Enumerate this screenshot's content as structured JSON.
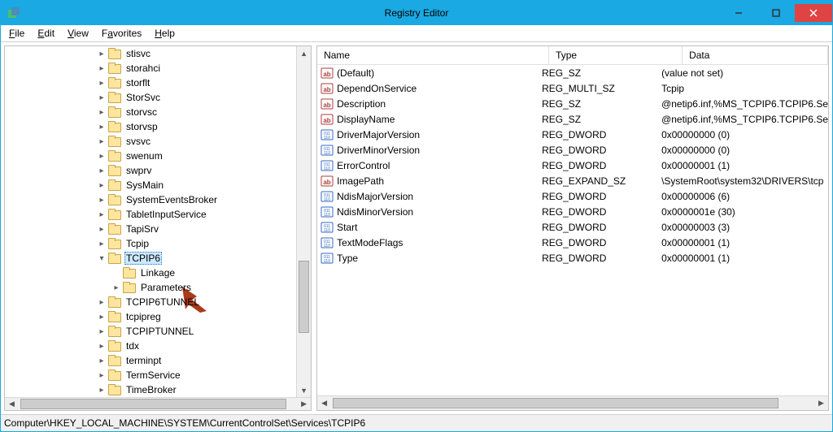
{
  "window": {
    "title": "Registry Editor"
  },
  "menu": {
    "items": [
      {
        "k": "F",
        "r": "ile"
      },
      {
        "k": "E",
        "r": "dit"
      },
      {
        "k": "V",
        "r": "iew"
      },
      {
        "k": "F",
        "r": "avorites",
        "pre": ""
      },
      {
        "k": "H",
        "r": "elp"
      }
    ]
  },
  "tree": {
    "indent_base": 112,
    "selected": "TCPIP6",
    "items": [
      {
        "l": "stisvc",
        "exp": "c"
      },
      {
        "l": "storahci",
        "exp": "c"
      },
      {
        "l": "storflt",
        "exp": "c"
      },
      {
        "l": "StorSvc",
        "exp": "c"
      },
      {
        "l": "storvsc",
        "exp": "c"
      },
      {
        "l": "storvsp",
        "exp": "c"
      },
      {
        "l": "svsvc",
        "exp": "c"
      },
      {
        "l": "swenum",
        "exp": "c"
      },
      {
        "l": "swprv",
        "exp": "c"
      },
      {
        "l": "SysMain",
        "exp": "c"
      },
      {
        "l": "SystemEventsBroker",
        "exp": "c"
      },
      {
        "l": "TabletInputService",
        "exp": "c"
      },
      {
        "l": "TapiSrv",
        "exp": "c"
      },
      {
        "l": "Tcpip",
        "exp": "c"
      },
      {
        "l": "TCPIP6",
        "exp": "o",
        "sel": true
      },
      {
        "l": "Linkage",
        "exp": "",
        "indent": 1
      },
      {
        "l": "Parameters",
        "exp": "c",
        "indent": 1
      },
      {
        "l": "TCPIP6TUNNEL",
        "exp": "c"
      },
      {
        "l": "tcpipreg",
        "exp": "c"
      },
      {
        "l": "TCPIPTUNNEL",
        "exp": "c"
      },
      {
        "l": "tdx",
        "exp": "c"
      },
      {
        "l": "terminpt",
        "exp": "c"
      },
      {
        "l": "TermService",
        "exp": "c"
      },
      {
        "l": "TimeBroker",
        "exp": "c"
      }
    ]
  },
  "list": {
    "columns": {
      "name": "Name",
      "type": "Type",
      "data": "Data"
    },
    "rows": [
      {
        "icon": "str",
        "name": "(Default)",
        "type": "REG_SZ",
        "data": "(value not set)"
      },
      {
        "icon": "str",
        "name": "DependOnService",
        "type": "REG_MULTI_SZ",
        "data": "Tcpip"
      },
      {
        "icon": "str",
        "name": "Description",
        "type": "REG_SZ",
        "data": "@netip6.inf,%MS_TCPIP6.TCPIP6.Se"
      },
      {
        "icon": "str",
        "name": "DisplayName",
        "type": "REG_SZ",
        "data": "@netip6.inf,%MS_TCPIP6.TCPIP6.Se"
      },
      {
        "icon": "bin",
        "name": "DriverMajorVersion",
        "type": "REG_DWORD",
        "data": "0x00000000 (0)"
      },
      {
        "icon": "bin",
        "name": "DriverMinorVersion",
        "type": "REG_DWORD",
        "data": "0x00000000 (0)"
      },
      {
        "icon": "bin",
        "name": "ErrorControl",
        "type": "REG_DWORD",
        "data": "0x00000001 (1)"
      },
      {
        "icon": "str",
        "name": "ImagePath",
        "type": "REG_EXPAND_SZ",
        "data": "\\SystemRoot\\system32\\DRIVERS\\tcp"
      },
      {
        "icon": "bin",
        "name": "NdisMajorVersion",
        "type": "REG_DWORD",
        "data": "0x00000006 (6)"
      },
      {
        "icon": "bin",
        "name": "NdisMinorVersion",
        "type": "REG_DWORD",
        "data": "0x0000001e (30)"
      },
      {
        "icon": "bin",
        "name": "Start",
        "type": "REG_DWORD",
        "data": "0x00000003 (3)"
      },
      {
        "icon": "bin",
        "name": "TextModeFlags",
        "type": "REG_DWORD",
        "data": "0x00000001 (1)"
      },
      {
        "icon": "bin",
        "name": "Type",
        "type": "REG_DWORD",
        "data": "0x00000001 (1)"
      }
    ]
  },
  "statusbar": {
    "path": "Computer\\HKEY_LOCAL_MACHINE\\SYSTEM\\CurrentControlSet\\Services\\TCPIP6"
  }
}
